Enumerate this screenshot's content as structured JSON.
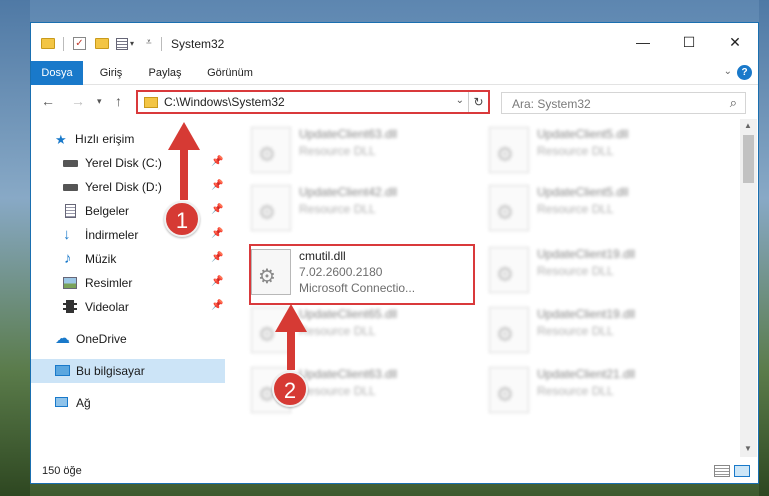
{
  "window": {
    "title": "System32",
    "controls": {
      "minimize": "—",
      "maximize": "☐",
      "close": "✕"
    }
  },
  "ribbon": {
    "tabs": [
      {
        "label": "Dosya"
      },
      {
        "label": "Giriş"
      },
      {
        "label": "Paylaş"
      },
      {
        "label": "Görünüm"
      }
    ],
    "help": "?"
  },
  "address": {
    "path": "C:\\Windows\\System32",
    "search_placeholder": "Ara: System32"
  },
  "nav": {
    "items": [
      {
        "label": "Hızlı erişim",
        "icon": "star-icon"
      },
      {
        "label": "Yerel Disk (C:)",
        "icon": "drive-icon",
        "pinned": true
      },
      {
        "label": "Yerel Disk (D:)",
        "icon": "drive-icon",
        "pinned": true
      },
      {
        "label": "Belgeler",
        "icon": "documents-icon",
        "pinned": true
      },
      {
        "label": "İndirmeler",
        "icon": "download-icon",
        "pinned": true
      },
      {
        "label": "Müzik",
        "icon": "music-icon",
        "pinned": true
      },
      {
        "label": "Resimler",
        "icon": "pictures-icon",
        "pinned": true
      },
      {
        "label": "Videolar",
        "icon": "videos-icon",
        "pinned": true
      },
      {
        "label": "OneDrive",
        "icon": "cloud-icon"
      },
      {
        "label": "Bu bilgisayar",
        "icon": "computer-icon",
        "selected": true
      },
      {
        "label": "Ağ",
        "icon": "network-icon"
      }
    ]
  },
  "files": {
    "left_column": [
      {
        "name": "UpdateClient63.dll",
        "type": "Resource DLL"
      },
      {
        "name": "UpdateClient42.dll",
        "type": "Resource DLL"
      },
      {
        "name": "cmutil.dll",
        "version": "7.02.2600.2180",
        "type": "Microsoft Connectio..."
      },
      {
        "name": "UpdateClient65.dll",
        "type": "Resource DLL"
      },
      {
        "name": "UpdateClient63.dll",
        "type": "Resource DLL"
      }
    ],
    "right_column": [
      {
        "name": "UpdateClient5.dll",
        "type": "Resource DLL"
      },
      {
        "name": "UpdateClient5.dll",
        "type": "Resource DLL"
      },
      {
        "name": "UpdateClient19.dll",
        "type": "Resource DLL"
      },
      {
        "name": "UpdateClient19.dll",
        "type": "Resource DLL"
      },
      {
        "name": "UpdateClient21.dll",
        "type": "Resource DLL"
      }
    ]
  },
  "status": {
    "count": "150 öğe"
  },
  "annotations": {
    "step1": "1",
    "step2": "2"
  },
  "colors": {
    "accent": "#1979ca",
    "highlight": "#d9393b",
    "selected": "#cce4f7"
  }
}
